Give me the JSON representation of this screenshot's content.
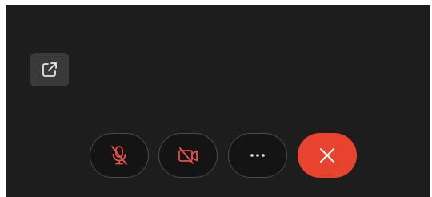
{
  "colors": {
    "call_background": "#1d1d1d",
    "control_background": "#141414",
    "control_border": "#4a4a4a",
    "off_icon_accent": "#e8504b",
    "end_call_accent": "#e8432e",
    "popout_background": "#3a3a3a"
  },
  "controls": {
    "popout": {
      "icon": "popout-icon"
    },
    "mute": {
      "icon": "microphone-off-icon",
      "state": "off"
    },
    "video": {
      "icon": "camera-off-icon",
      "state": "off"
    },
    "more": {
      "icon": "more-options-icon",
      "glyph": "···"
    },
    "end": {
      "icon": "close-icon"
    }
  }
}
